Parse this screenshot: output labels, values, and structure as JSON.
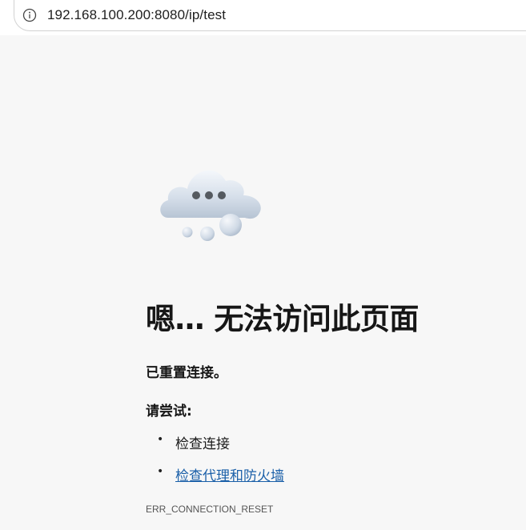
{
  "browser": {
    "url": "192.168.100.200:8080/ip/test",
    "info_icon": "info-circle-icon"
  },
  "error_page": {
    "illustration": "cloud-with-ellipsis-icon",
    "title": "嗯… 无法访问此页面",
    "summary": "已重置连接。",
    "try_heading": "请尝试:",
    "suggestions": [
      {
        "label": "检查连接",
        "is_link": false
      },
      {
        "label": "检查代理和防火墙",
        "is_link": true
      }
    ],
    "error_code": "ERR_CONNECTION_RESET",
    "link_color": "#1a5fa8"
  }
}
